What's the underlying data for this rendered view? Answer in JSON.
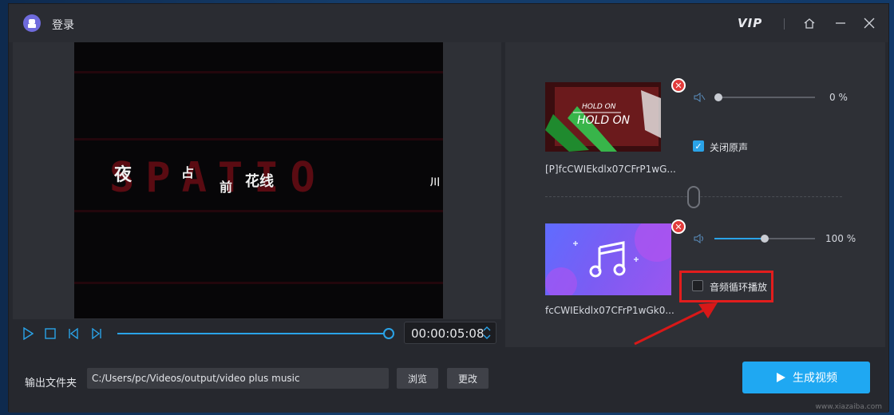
{
  "titlebar": {
    "login_label": "登录",
    "vip_label": "VIP"
  },
  "player": {
    "time": "00:00:05:08",
    "progress_fraction": 0.99
  },
  "video_overlay": {
    "text": "SPATIO",
    "fragments": [
      "夜",
      "占",
      "前",
      "花线",
      "川"
    ]
  },
  "video_track": {
    "thumbnail_text_1": "HOLD ON",
    "thumbnail_text_2": "HOLD ON",
    "file_name": "[P]fcCWIEkdlx07CFrP1wG...",
    "volume_percent": "0 %",
    "volume_fraction": 0.0,
    "mute_original_label": "关闭原声",
    "mute_original_checked": true
  },
  "audio_track": {
    "file_name": "fcCWIEkdlx07CFrP1wGk0...",
    "volume_percent": "100 %",
    "volume_fraction": 0.5,
    "loop_label": "音频循环播放",
    "loop_checked": false
  },
  "output": {
    "label": "输出文件夹",
    "path": "C:/Users/pc/Videos/output/video plus music",
    "browse_label": "浏览",
    "change_label": "更改",
    "generate_label": "生成视频"
  },
  "watermark": "www.xiazaiba.com",
  "colors": {
    "accent": "#2aa3e8",
    "primary_button": "#1fa8f2",
    "highlight": "#e21d1d",
    "delete": "#e23b3b"
  }
}
